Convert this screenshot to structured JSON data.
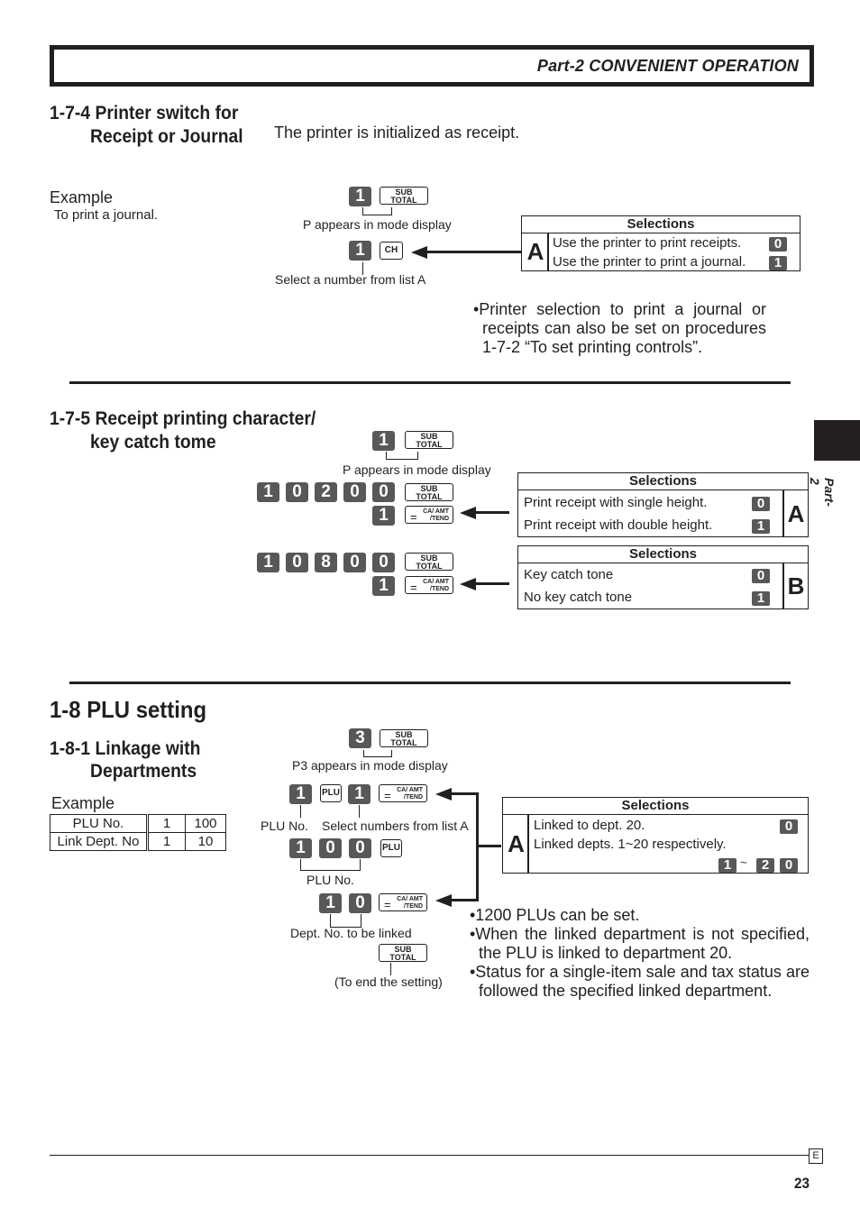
{
  "header": {
    "title": "Part-2 CONVENIENT OPERATION"
  },
  "side_tab": {
    "label": "Part-2"
  },
  "section_174": {
    "heading_line1": "1-7-4  Printer switch for",
    "heading_line2": "Receipt or Journal",
    "intro": "The printer is initialized as receipt.",
    "example_label": "Example",
    "example_desc": "To print a journal.",
    "step1": {
      "keys": [
        "1"
      ],
      "func_key": "SUB TOTAL",
      "caption": "P appears in  mode display"
    },
    "step2": {
      "keys": [
        "1"
      ],
      "func_key": "CH",
      "caption": "Select a number from list A"
    },
    "selections": {
      "title": "Selections",
      "letter": "A",
      "rows": [
        {
          "label": "Use the printer to print receipts.",
          "value": "0"
        },
        {
          "label": "Use the printer to print a journal.",
          "value": "1"
        }
      ]
    },
    "note": "•Printer selection to print a journal or receipts can also be set on procedures 1-7-2 “To set printing controls”."
  },
  "section_175": {
    "heading_line1": "1-7-5  Receipt printing character/",
    "heading_line2": "key catch tome",
    "step1": {
      "keys": [
        "1"
      ],
      "func_key": "SUB TOTAL",
      "caption": "P appears in  mode display"
    },
    "step2": {
      "keys": [
        "1",
        "0",
        "2",
        "0",
        "0"
      ],
      "func_key": "SUB TOTAL",
      "sel_key": "1",
      "sel_func": "= CA/AMT/TEND"
    },
    "step3": {
      "keys": [
        "1",
        "0",
        "8",
        "0",
        "0"
      ],
      "func_key": "SUB TOTAL",
      "sel_key": "1",
      "sel_func": "= CA/AMT/TEND"
    },
    "selections_a": {
      "title": "Selections",
      "letter": "A",
      "rows": [
        {
          "label": "Print receipt with single height.",
          "value": "0"
        },
        {
          "label": "Print receipt with double height.",
          "value": "1"
        }
      ]
    },
    "selections_b": {
      "title": "Selections",
      "letter": "B",
      "rows": [
        {
          "label": "Key catch tone",
          "value": "0"
        },
        {
          "label": "No key catch tone",
          "value": "1"
        }
      ]
    }
  },
  "section_18": {
    "heading": "1-8  PLU setting",
    "sub_heading_line1": "1-8-1  Linkage with",
    "sub_heading_line2": "Departments",
    "example_label": "Example",
    "example_table": {
      "rows": [
        {
          "label": "PLU No.",
          "values": [
            "1",
            "100"
          ]
        },
        {
          "label": "Link Dept. No",
          "values": [
            "1",
            "10"
          ]
        }
      ]
    },
    "step1": {
      "keys": [
        "3"
      ],
      "func_key": "SUB TOTAL",
      "caption": "P3 appears in mode display"
    },
    "step2": {
      "keys": [
        "1"
      ],
      "plu_key": "PLU",
      "sel_key": "1",
      "func_key": "= CA/AMT/TEND",
      "caption_left": "PLU No.",
      "caption_right": "Select numbers from list A"
    },
    "step3": {
      "keys": [
        "1",
        "0",
        "0"
      ],
      "plu_key": "PLU",
      "caption": "PLU No."
    },
    "step4": {
      "keys": [
        "1",
        "0"
      ],
      "func_key": "= CA/AMT/TEND",
      "caption": "Dept. No. to be linked"
    },
    "step5": {
      "func_key": "SUB TOTAL",
      "caption": "(To end the setting)"
    },
    "selections": {
      "title": "Selections",
      "letter": "A",
      "rows": [
        {
          "label": "Linked to dept. 20.",
          "value": "0"
        },
        {
          "label": "Linked depts. 1~20 respectively.",
          "value_from": "1",
          "tilde": "~",
          "value_to": [
            "2",
            "0"
          ]
        }
      ]
    },
    "notes": [
      "•1200 PLUs can be set.",
      "•When the linked department is not specified, the PLU is linked to department 20.",
      "•Status for a single-item sale and tax status are followed the specified linked department."
    ]
  },
  "keys": {
    "sub": "SUB",
    "total": "TOTAL",
    "ca": "CA/",
    "amt": "AMT",
    "tend": "/TEND",
    "eq": "="
  },
  "footer": {
    "lang_box": "E",
    "page_number": "23"
  }
}
